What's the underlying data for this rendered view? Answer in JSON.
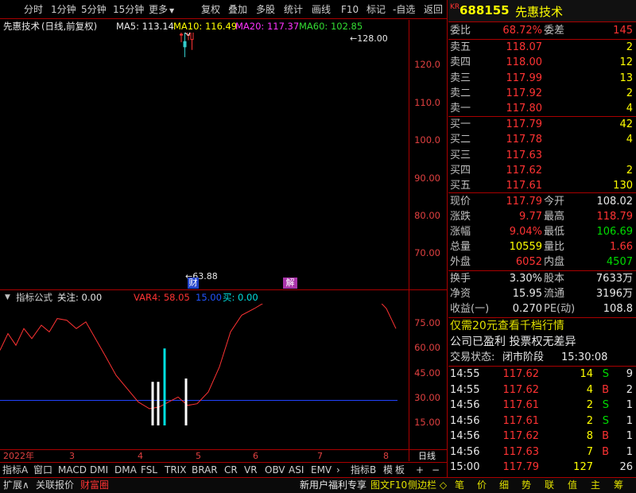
{
  "toolbar": {
    "left": [
      "分时",
      "1分钟",
      "5分钟",
      "15分钟",
      "更多"
    ],
    "right": [
      "复权",
      "叠加",
      "多股",
      "统计",
      "画线",
      "F10",
      "标记",
      "-自选",
      "返回"
    ]
  },
  "chart_header": {
    "stock": "先惠技术",
    "mode": "(日线,前复权)",
    "ma5": "MA5: 113.14",
    "ma10": "MA10: 116.49",
    "ma20": "MA20: 117.37",
    "ma60": "MA60: 102.85",
    "ma5_color": "#e8e8e8",
    "ma10_color": "#ffff00",
    "ma20_color": "#ff33ff",
    "ma60_color": "#33dd33"
  },
  "price_axis": [
    "120.0",
    "110.0",
    "100.0",
    "90.00",
    "80.00",
    "70.00"
  ],
  "annotations": {
    "high": "128.00",
    "low": "63.88",
    "event1": "财",
    "event2": "解"
  },
  "indicator_header": {
    "name": "指标公式",
    "focus": "关注: 0.00",
    "var4": "VAR4: 58.05",
    "val15": "15.00",
    "buy": "买: 0.00"
  },
  "indicator_axis": [
    "75.00",
    "60.00",
    "45.00",
    "30.00",
    "15.00"
  ],
  "date_axis": {
    "year": "2022年",
    "months": [
      "3",
      "4",
      "5",
      "6",
      "7",
      "8"
    ],
    "period": "日线"
  },
  "indicator_tabs": [
    "指标A",
    "窗口",
    "MACD",
    "DMI",
    "DMA",
    "FSL",
    "TRIX",
    "BRAR",
    "CR",
    "VR",
    "OBV",
    "ASI",
    "EMV"
  ],
  "indicator_tabs_right": [
    "指标B",
    "模",
    "板"
  ],
  "bottom_left": [
    "扩展∧",
    "关联报价",
    "财富圈"
  ],
  "bottom_mid": [
    "新用户福利专享",
    "图文F10",
    "侧边栏 ◇"
  ],
  "bottom_right": [
    "笔",
    "价",
    "细",
    "势",
    "联",
    "值",
    "主",
    "筹"
  ],
  "quote": {
    "logo": "KR",
    "code": "688155",
    "name": "先惠技术",
    "weibi_label": "委比",
    "weibi": "68.72%",
    "weicha_label": "委差",
    "weicha": "145",
    "asks": [
      {
        "label": "卖五",
        "price": "118.07",
        "vol": "2"
      },
      {
        "label": "卖四",
        "price": "118.00",
        "vol": "12"
      },
      {
        "label": "卖三",
        "price": "117.99",
        "vol": "13"
      },
      {
        "label": "卖二",
        "price": "117.92",
        "vol": "2"
      },
      {
        "label": "卖一",
        "price": "117.80",
        "vol": "4"
      }
    ],
    "bids": [
      {
        "label": "买一",
        "price": "117.79",
        "vol": "42"
      },
      {
        "label": "买二",
        "price": "117.78",
        "vol": "4"
      },
      {
        "label": "买三",
        "price": "117.63",
        "vol": ""
      },
      {
        "label": "买四",
        "price": "117.62",
        "vol": "2"
      },
      {
        "label": "买五",
        "price": "117.61",
        "vol": "130"
      }
    ],
    "stats": [
      {
        "l1": "现价",
        "v1": "117.79",
        "c1": "red",
        "l2": "今开",
        "v2": "108.02",
        "c2": "wht"
      },
      {
        "l1": "涨跌",
        "v1": "9.77",
        "c1": "red",
        "l2": "最高",
        "v2": "118.79",
        "c2": "red"
      },
      {
        "l1": "涨幅",
        "v1": "9.04%",
        "c1": "red",
        "l2": "最低",
        "v2": "106.69",
        "c2": "grn"
      },
      {
        "l1": "总量",
        "v1": "10559",
        "c1": "yel",
        "l2": "量比",
        "v2": "1.66",
        "c2": "red"
      },
      {
        "l1": "外盘",
        "v1": "6052",
        "c1": "red",
        "l2": "内盘",
        "v2": "4507",
        "c2": "grn"
      }
    ],
    "stats2": [
      {
        "l1": "换手",
        "v1": "3.30%",
        "l2": "股本",
        "v2": "7633万"
      },
      {
        "l1": "净资",
        "v1": "15.95",
        "l2": "流通",
        "v2": "3196万"
      },
      {
        "l1": "收益(一)",
        "v1": "0.270",
        "l2": "PE(动)",
        "v2": "108.8"
      }
    ],
    "promo": "仅需20元查看千档行情",
    "info": "公司已盈利 投票权无差异",
    "status_label": "交易状态:",
    "status": "闭市阶段",
    "status_time": "15:30:08",
    "ticks": [
      {
        "t": "14:55",
        "p": "117.62",
        "v": "14",
        "s": "S",
        "n": "9"
      },
      {
        "t": "14:55",
        "p": "117.62",
        "v": "4",
        "s": "B",
        "n": "2"
      },
      {
        "t": "14:56",
        "p": "117.61",
        "v": "2",
        "s": "S",
        "n": "1"
      },
      {
        "t": "14:56",
        "p": "117.61",
        "v": "2",
        "s": "S",
        "n": "1"
      },
      {
        "t": "14:56",
        "p": "117.62",
        "v": "8",
        "s": "B",
        "n": "1"
      },
      {
        "t": "14:56",
        "p": "117.63",
        "v": "7",
        "s": "B",
        "n": "1"
      },
      {
        "t": "15:00",
        "p": "117.79",
        "v": "127",
        "s": "",
        "n": "26"
      }
    ]
  }
}
